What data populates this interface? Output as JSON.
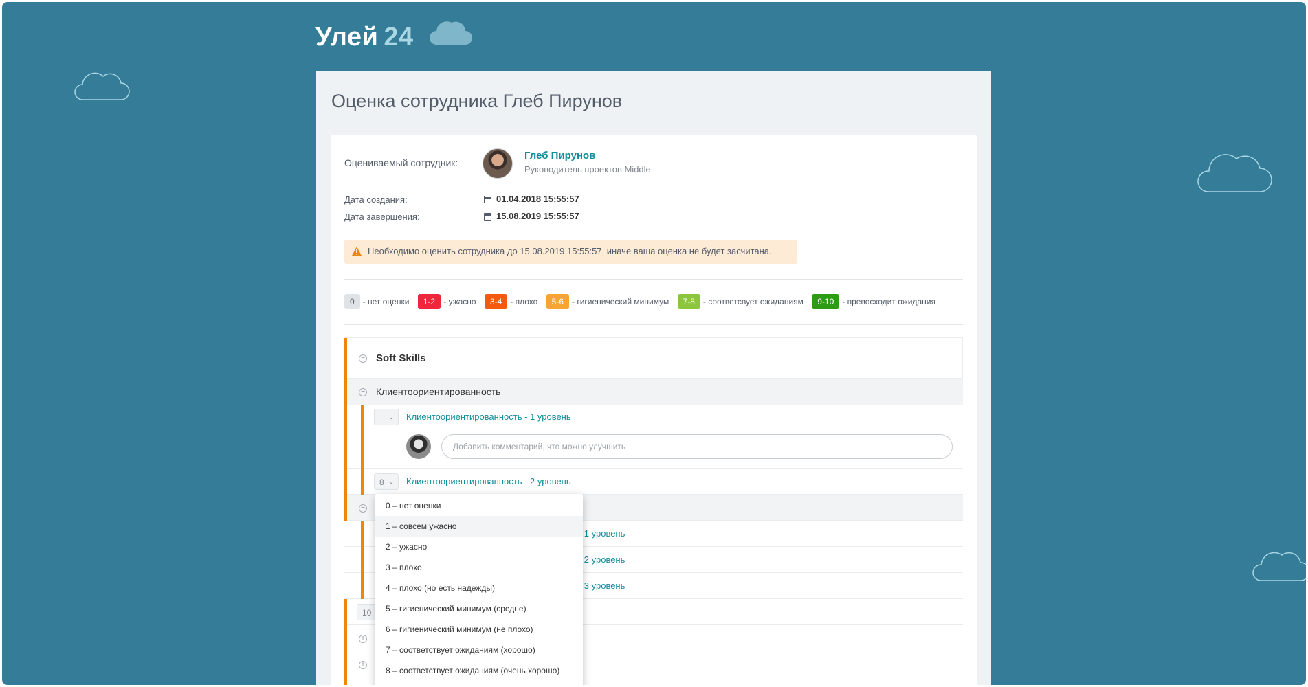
{
  "app": {
    "logo_text": "Улей",
    "logo_number": "24"
  },
  "page": {
    "title": "Оценка сотрудника Глеб Пирунов"
  },
  "employee": {
    "label": "Оцениваемый сотрудник:",
    "name": "Глеб Пирунов",
    "position": "Руководитель проектов Middle"
  },
  "dates": {
    "created_label": "Дата создания:",
    "created_value": "01.04.2018 15:55:57",
    "finished_label": "Дата завершения:",
    "finished_value": "15.08.2019 15:55:57"
  },
  "warning": {
    "text": "Необходимо оценить сотрудника до 15.08.2019 15:55:57, иначе ваша оценка не будет засчитана."
  },
  "legend": [
    {
      "badge": "0",
      "text": "- нет оценки",
      "color": "#dfe3e6",
      "text_color": "#535c69"
    },
    {
      "badge": "1-2",
      "text": "- ужасно",
      "color": "#f0263c",
      "text_color": "#ffffff"
    },
    {
      "badge": "3-4",
      "text": "- плохо",
      "color": "#f4590f",
      "text_color": "#ffffff"
    },
    {
      "badge": "5-6",
      "text": "- гигиенический минимум",
      "color": "#f6a532",
      "text_color": "#ffffff"
    },
    {
      "badge": "7-8",
      "text": "- соответсвует ожиданиям",
      "color": "#8cc63f",
      "text_color": "#ffffff"
    },
    {
      "badge": "9-10",
      "text": "- превосходит ожидания",
      "color": "#2e9b15",
      "text_color": "#ffffff"
    }
  ],
  "tree": {
    "section_title": "Soft Skills",
    "subsection_title": "Клиентоориентированность",
    "level1_label": "Клиентоориентированность - 1 уровень",
    "level1_score": "",
    "comment_placeholder": "Добавить комментарий, что можно улучшить",
    "level2_label": "Клиентоориентированность - 2 уровень",
    "level2_score": "8",
    "hidden_rows": [
      {
        "label": "е - 1 уровень"
      },
      {
        "label": "е - 2 уровень"
      },
      {
        "label": "е - 3 уровень"
      }
    ],
    "partial_score": "10"
  },
  "dropdown": {
    "options": [
      "0 – нет оценки",
      "1 – совсем ужасно",
      "2 – ужасно",
      "3 – плохо",
      "4 – плохо (но есть надежды)",
      "5 – гигиенический минимум (средне)",
      "6 – гигиенический минимум (не плохо)",
      "7 – соответствует ожиданиям (хорошо)",
      "8 – соответствует ожиданиям (очень хорошо)"
    ],
    "highlighted": "1 – совсем ужасно"
  },
  "colors": {
    "background": "#347c97",
    "accent": "#0f8f9c",
    "section_bar": "#f0850a",
    "warning_bg": "#fdebd6"
  }
}
